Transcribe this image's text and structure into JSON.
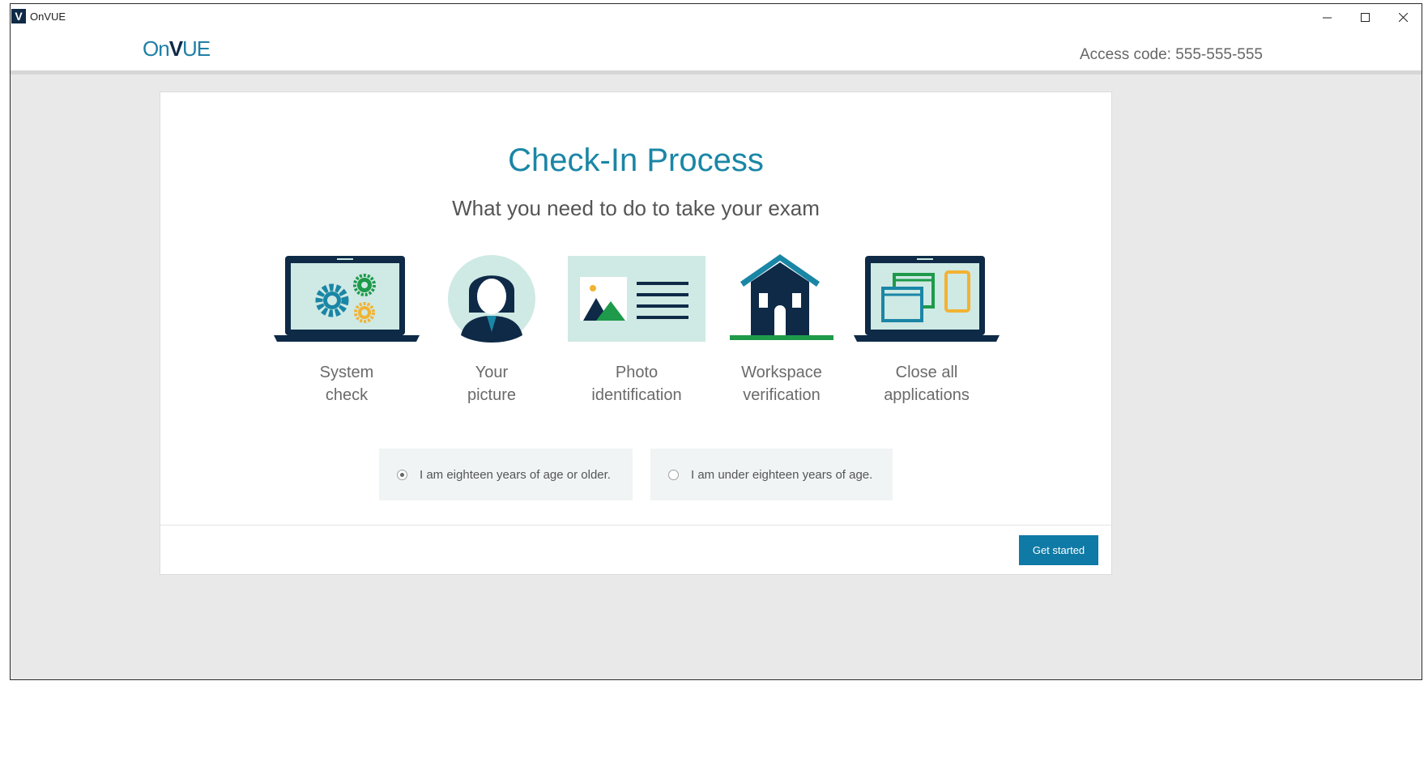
{
  "window": {
    "title": "OnVUE",
    "icon_letter": "V",
    "controls": [
      "minimize-icon",
      "maximize-icon",
      "close-icon"
    ]
  },
  "header": {
    "logo_on": "On",
    "logo_v": "V",
    "logo_ue": "UE",
    "access_code": "Access code: 555-555-555"
  },
  "card": {
    "title": "Check-In Process",
    "subtitle": "What you need to do to take your exam",
    "steps": [
      {
        "label": "System\ncheck",
        "icon": "laptop-gears-icon"
      },
      {
        "label": "Your\npicture",
        "icon": "person-icon"
      },
      {
        "label": "Photo\nidentification",
        "icon": "id-card-icon"
      },
      {
        "label": "Workspace\nverification",
        "icon": "house-icon"
      },
      {
        "label": "Close all\napplications",
        "icon": "laptop-windows-icon"
      }
    ],
    "age_options": [
      {
        "label": "I am eighteen years of age or older.",
        "checked": true
      },
      {
        "label": "I am under eighteen years of age.",
        "checked": false
      }
    ],
    "primary_button": "Get started"
  },
  "colors": {
    "accent": "#1a86a6",
    "navy": "#0e2a47",
    "button": "#0f7aa6",
    "green": "#1e9a4a",
    "gold": "#f2b233"
  }
}
